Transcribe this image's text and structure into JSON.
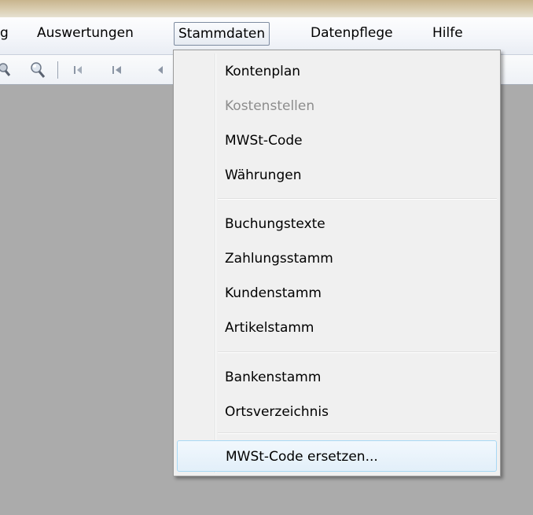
{
  "menubar": {
    "items": [
      {
        "label": "g"
      },
      {
        "label": "Auswertungen"
      },
      {
        "label": "Stammdaten"
      },
      {
        "label": "Datenpflege"
      },
      {
        "label": "Hilfe"
      }
    ]
  },
  "toolbar": {
    "icons": [
      "zoom-icon",
      "find-icon",
      "first-record-icon",
      "first-icon",
      "previous-icon"
    ]
  },
  "dropdown": {
    "items": [
      {
        "label": "Kontenplan",
        "enabled": true
      },
      {
        "label": "Kostenstellen",
        "enabled": false
      },
      {
        "label": "MWSt-Code",
        "enabled": true
      },
      {
        "label": "Währungen",
        "enabled": true
      },
      {
        "label": "Buchungstexte",
        "enabled": true
      },
      {
        "label": "Zahlungsstamm",
        "enabled": true
      },
      {
        "label": "Kundenstamm",
        "enabled": true
      },
      {
        "label": "Artikelstamm",
        "enabled": true
      },
      {
        "label": "Bankenstamm",
        "enabled": true
      },
      {
        "label": "Ortsverzeichnis",
        "enabled": true
      },
      {
        "label": "MWSt-Code ersetzen...",
        "enabled": true,
        "highlighted": true
      }
    ]
  },
  "colors": {
    "desktop": "#ababab",
    "menu_background": "#f0f0f0",
    "highlight_border": "#a8d8f4",
    "disabled_text": "#8d8d8d"
  }
}
